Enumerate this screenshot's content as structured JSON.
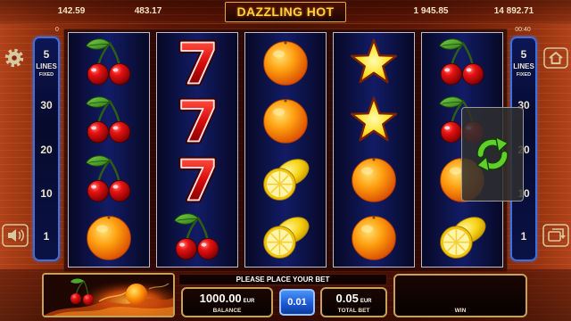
{
  "game": {
    "title": "DAZZLING HOT"
  },
  "top_bar": {
    "jackpots": [
      "142.59",
      "483.17",
      "1 945.85",
      "14 892.71"
    ],
    "counter": "0",
    "timer": "00:40"
  },
  "lines_panel": {
    "count": "5",
    "label": "LINES",
    "mode": "FIXED",
    "markers": [
      "30",
      "20",
      "10",
      "1"
    ]
  },
  "reels": [
    [
      "cherry",
      "cherry",
      "cherry",
      "orange"
    ],
    [
      "seven",
      "seven",
      "seven",
      "cherry"
    ],
    [
      "orange",
      "orange",
      "lemon",
      "lemon"
    ],
    [
      "star",
      "star",
      "orange",
      "orange"
    ],
    [
      "cherry",
      "cherry",
      "orange",
      "lemon"
    ]
  ],
  "message": "PLEASE PLACE YOUR BET",
  "balance": {
    "value": "1000.00",
    "currency": "EUR",
    "label": "BALANCE"
  },
  "coin": {
    "value": "0.01"
  },
  "total_bet": {
    "value": "0.05",
    "currency": "EUR",
    "label": "TOTAL BET"
  },
  "win": {
    "label": "WIN"
  },
  "icons": {
    "settings": "gear-icon",
    "home": "home-icon",
    "sound": "speaker-icon",
    "autoplay": "autoplay-icon",
    "loading": "refresh-icon"
  },
  "colors": {
    "accent_gold": "#ffd23c",
    "panel_blue": "#3c6fe0",
    "coin_blue": "#1e5ad8",
    "reel_navy": "#121c66",
    "frame_gold": "#c9a05a",
    "loading_green": "#5fcf2a"
  }
}
